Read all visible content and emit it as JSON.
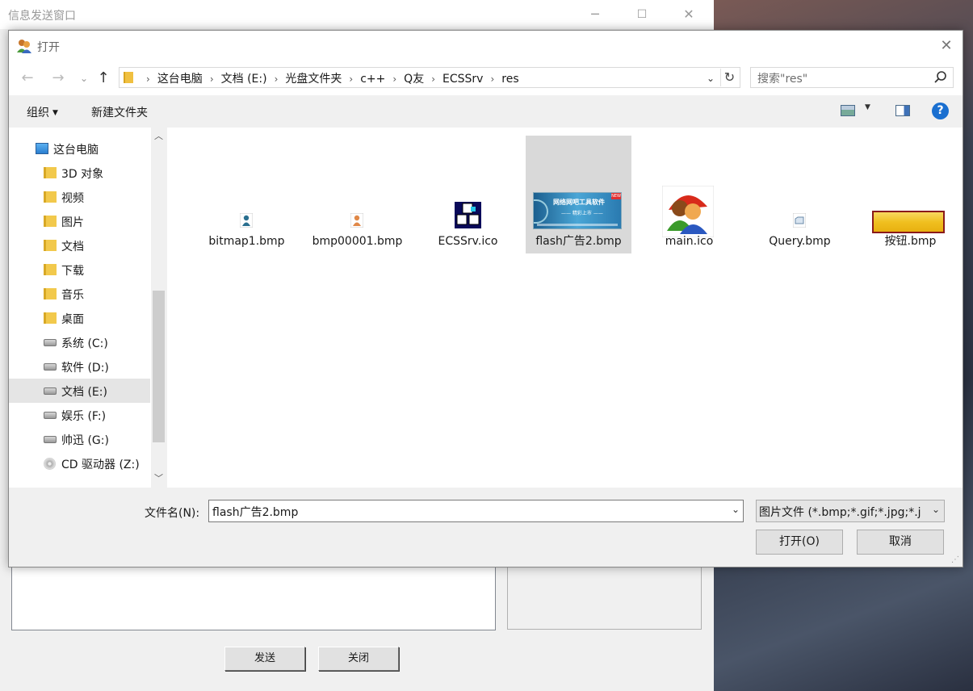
{
  "bg_window": {
    "title": "信息发送窗口",
    "minimize": "─",
    "maximize": "☐",
    "close": "✕",
    "send_label": "发送",
    "close_label": "关闭"
  },
  "dialog": {
    "title": "打开",
    "close": "✕",
    "nav": {
      "back": "←",
      "forward": "→",
      "recent": "⌄",
      "up": "↑"
    },
    "breadcrumbs": [
      "这台电脑",
      "文档 (E:)",
      "光盘文件夹",
      "c++",
      "Q友",
      "ECSSrv",
      "res"
    ],
    "crumb_sep": "›",
    "address_dropdown": "⌄",
    "refresh": "↻",
    "search_placeholder": "搜索\"res\"",
    "toolbar": {
      "organize": "组织",
      "organize_caret": "▼",
      "new_folder": "新建文件夹",
      "view_caret": "▼",
      "help": "?"
    },
    "sidebar": {
      "scroll_up": "︿",
      "scroll_down": "﹀",
      "items": [
        {
          "label": "这台电脑",
          "icon": "computer-icon"
        },
        {
          "label": "3D 对象",
          "icon": "folder-icon"
        },
        {
          "label": "视频",
          "icon": "folder-icon"
        },
        {
          "label": "图片",
          "icon": "folder-icon"
        },
        {
          "label": "文档",
          "icon": "folder-icon"
        },
        {
          "label": "下载",
          "icon": "folder-icon"
        },
        {
          "label": "音乐",
          "icon": "folder-icon"
        },
        {
          "label": "桌面",
          "icon": "folder-icon"
        },
        {
          "label": "系统 (C:)",
          "icon": "drive-icon"
        },
        {
          "label": "软件 (D:)",
          "icon": "drive-icon"
        },
        {
          "label": "文档 (E:)",
          "icon": "drive-icon",
          "selected": true
        },
        {
          "label": "娱乐 (F:)",
          "icon": "drive-icon"
        },
        {
          "label": "帅迅 (G:)",
          "icon": "drive-icon"
        },
        {
          "label": "CD 驱动器 (Z:)",
          "icon": "cd-drive-icon"
        }
      ]
    },
    "files": [
      {
        "name": "bitmap1.bmp"
      },
      {
        "name": "bmp00001.bmp"
      },
      {
        "name": "ECSSrv.ico"
      },
      {
        "name": "flash广告2.bmp",
        "selected": true,
        "banner_text": "网络网吧工具软件",
        "banner_sub": "—— 精彩上市 ——",
        "banner_tag": "NEW"
      },
      {
        "name": "main.ico"
      },
      {
        "name": "Query.bmp"
      },
      {
        "name": "按钮.bmp"
      }
    ],
    "filename_label": "文件名(N):",
    "filename_value": "flash广告2.bmp",
    "filetype_value": "图片文件 (*.bmp;*.gif;*.jpg;*.j",
    "dropdown_arrow": "⌄",
    "open_button": "打开(O)",
    "cancel_button": "取消",
    "resize_grip": "⋰"
  }
}
